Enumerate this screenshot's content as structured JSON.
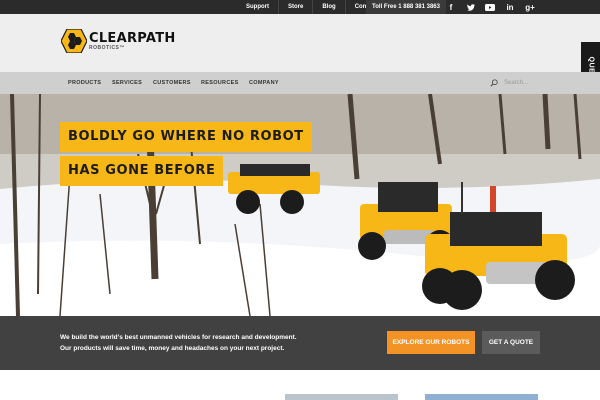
{
  "topbar": {
    "links": [
      "Support",
      "Store",
      "Blog",
      "Contact"
    ],
    "toll_free": "Toll Free 1 888 381 3863",
    "social": [
      "f",
      "t",
      "▶",
      "in",
      "g+"
    ]
  },
  "logo": {
    "name": "CLEARPATH",
    "sub": "ROBOTICS™"
  },
  "questions_tab": "QUESTIONS",
  "nav": {
    "items": [
      "PRODUCTS",
      "SERVICES",
      "CUSTOMERS",
      "RESOURCES",
      "COMPANY"
    ],
    "search_placeholder": "Search..."
  },
  "hero": {
    "line1": "BOLDLY GO WHERE NO ROBOT",
    "line2": "HAS GONE BEFORE"
  },
  "cta": {
    "text_line1": "We build the world’s best unmanned vehicles for research and development.",
    "text_line2": "Our products will save time, money and headaches on your next project.",
    "explore_label": "EXPLORE OUR ROBOTS",
    "quote_label": "GET A QUOTE"
  },
  "colors": {
    "accent": "#f7b817",
    "cta_orange": "#f39325",
    "dark": "#2b2b2b"
  }
}
